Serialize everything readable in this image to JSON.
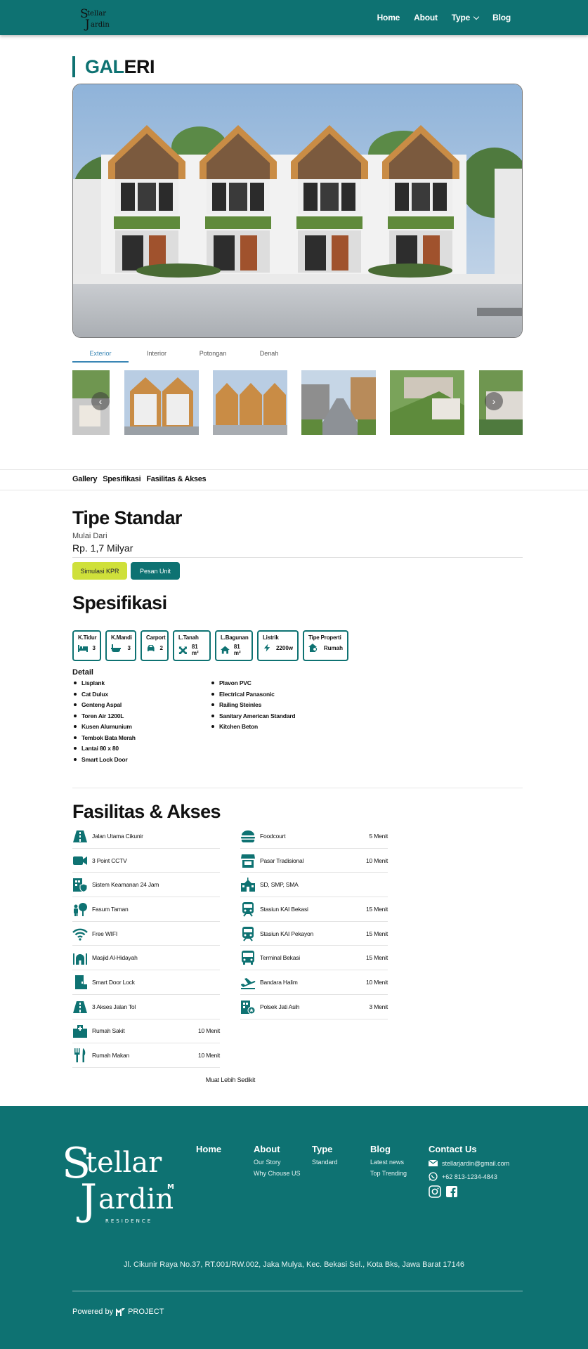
{
  "nav": {
    "logo_text_1": "Stellar",
    "logo_text_2": "Jardin",
    "items": [
      {
        "label": "Home"
      },
      {
        "label": "About"
      },
      {
        "label": "Type"
      },
      {
        "label": "Blog"
      }
    ]
  },
  "gallery": {
    "title_accent": "GAL",
    "title_rest": "ERI",
    "tabs": [
      "Exterior",
      "Interior",
      "Potongan",
      "Denah"
    ],
    "active_tab": "Exterior"
  },
  "subnav": [
    "Gallery",
    "Spesifikasi",
    "Fasilitas & Akses"
  ],
  "tipe": {
    "title": "Tipe Standar",
    "mulai": "Mulai Dari",
    "harga": "Rp. 1,7 Milyar",
    "btn_kpr": "Simulasi KPR",
    "btn_pesan": "Pesan Unit"
  },
  "spesifikasi": {
    "title": "Spesifikasi",
    "cards": [
      {
        "label": "K.Tidur",
        "value": "3",
        "icon": "bed-icon"
      },
      {
        "label": "K.Mandi",
        "value": "3",
        "icon": "bathtub-icon"
      },
      {
        "label": "Carport",
        "value": "2",
        "icon": "car-icon"
      },
      {
        "label": "L.Tanah",
        "value": "81 m²",
        "icon": "land-area-icon"
      },
      {
        "label": "L.Bagunan",
        "value": "81 m²",
        "icon": "house-icon"
      },
      {
        "label": "Listrik",
        "value": "2200w",
        "icon": "bolt-icon"
      },
      {
        "label": "Tipe Properti",
        "value": "Rumah",
        "icon": "home-search-icon"
      }
    ],
    "detail_title": "Detail",
    "detail_left": [
      "Lisplank",
      "Cat Dulux",
      "Genteng Aspal",
      "Toren Air 1200L",
      "Kusen Alumunium",
      "Tembok Bata Merah",
      "Lantai 80 x 80",
      "Smart Lock Door"
    ],
    "detail_right": [
      "Plavon PVC",
      "Electrical Panasonic",
      "Railing Steinles",
      "Sanitary American Standard",
      "Kitchen Beton"
    ]
  },
  "fasilitas": {
    "title": "Fasilitas & Akses",
    "left": [
      {
        "name": "Jalan Utama Cikunir",
        "dist": "",
        "icon": "road-icon"
      },
      {
        "name": "3 Point CCTV",
        "dist": "",
        "icon": "video-camera-icon"
      },
      {
        "name": "Sistem Keamanan 24 Jam",
        "dist": "",
        "icon": "building-shield-icon"
      },
      {
        "name": "Fasum Taman",
        "dist": "",
        "icon": "tree-person-icon"
      },
      {
        "name": "Free WIFI",
        "dist": "",
        "icon": "wifi-icon"
      },
      {
        "name": "Masjid Al-Hidayah",
        "dist": "",
        "icon": "mosque-icon"
      },
      {
        "name": "Smart Door Lock",
        "dist": "",
        "icon": "door-icon"
      },
      {
        "name": "3 Akses Jalan Tol",
        "dist": "",
        "icon": "road-icon"
      },
      {
        "name": "Rumah Sakit",
        "dist": "10 Menit",
        "icon": "hospital-icon"
      },
      {
        "name": "Rumah Makan",
        "dist": "10 Menit",
        "icon": "utensils-icon"
      }
    ],
    "right": [
      {
        "name": "Foodcourt",
        "dist": "5 Menit",
        "icon": "burger-icon"
      },
      {
        "name": "Pasar Tradisional",
        "dist": "10 Menit",
        "icon": "store-icon"
      },
      {
        "name": "SD, SMP, SMA",
        "dist": "",
        "icon": "school-icon"
      },
      {
        "name": "Stasiun KAI Bekasi",
        "dist": "15 Menit",
        "icon": "train-icon"
      },
      {
        "name": "Stasiun KAI Pekayon",
        "dist": "15 Menit",
        "icon": "train-icon"
      },
      {
        "name": "Terminal Bekasi",
        "dist": "15 Menit",
        "icon": "bus-icon"
      },
      {
        "name": "Bandara Halim",
        "dist": "10 Menit",
        "icon": "plane-icon"
      },
      {
        "name": "Polsek Jati Asih",
        "dist": "3 Menit",
        "icon": "police-building-icon"
      }
    ],
    "more": "Muat Lebih Sedikit"
  },
  "footer": {
    "logo_text_1": "Stellar",
    "logo_text_2": "Jardin",
    "logo_sub": "RESIDENCE",
    "columns": [
      {
        "head": "Home",
        "links": []
      },
      {
        "head": "About",
        "links": [
          "Our Story",
          "Why Chouse US"
        ]
      },
      {
        "head": "Type",
        "links": [
          "Standard"
        ]
      },
      {
        "head": "Blog",
        "links": [
          "Latest news",
          "Top Trending"
        ]
      }
    ],
    "contact_head": "Contact Us",
    "email": "stellarjardin@gmail.com",
    "phone": "+62 813-1234-4843",
    "address": "Jl. Cikunir Raya No.37, RT.001/RW.002, Jaka Mulya, Kec. Bekasi Sel., Kota Bks, Jawa Barat 17146",
    "powered_label": "Powered by",
    "powered_brand": "PROJECT"
  },
  "colors": {
    "primary": "#0e7272",
    "accent": "#cfe03a",
    "tab_active": "#3a86b5"
  }
}
